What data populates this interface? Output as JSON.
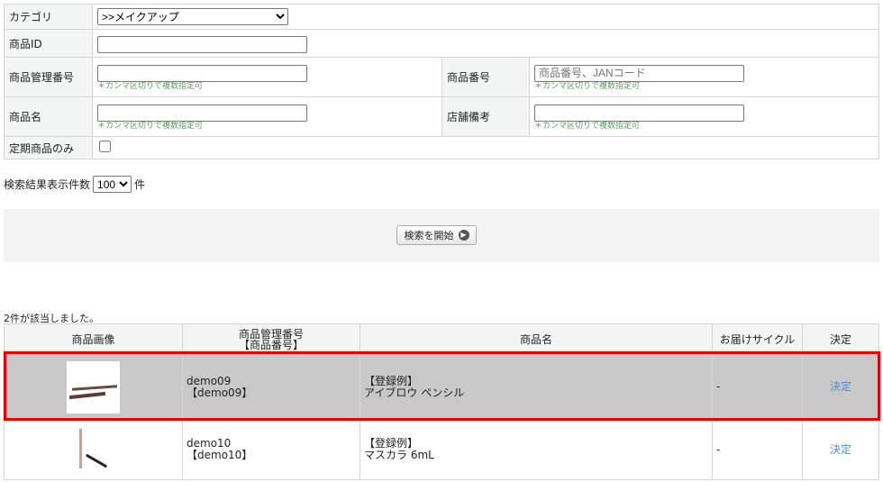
{
  "search": {
    "category_label": "カテゴリ",
    "category_value": ">>メイクアップ",
    "product_id_label": "商品ID",
    "product_id_value": "",
    "mgmt_no_label": "商品管理番号",
    "mgmt_no_value": "",
    "mgmt_no_note": "＊カンマ区切りで複数指定可",
    "product_no_label": "商品番号",
    "product_no_placeholder": "商品番号、JANコード",
    "product_no_note": "＊カンマ区切りで複数指定可",
    "name_label": "商品名",
    "name_value": "",
    "name_note": "＊カンマ区切りで複数指定可",
    "store_note_label": "店舗備考",
    "store_note_value": "",
    "store_note_note": "＊カンマ区切りで複数指定可",
    "subscription_label": "定期商品のみ"
  },
  "count": {
    "label": "検索結果表示件数",
    "value": "100",
    "unit": "件"
  },
  "search_button": "検索を開始",
  "results": {
    "summary": "2件が該当しました。",
    "headers": [
      "商品画像",
      "商品管理番号",
      "【商品番号】",
      "商品名",
      "お届けサイクル",
      "決定"
    ],
    "rows": [
      {
        "mgmt": "demo09",
        "no": "【demo09】",
        "name1": "【登録例】",
        "name2": "アイブロウ ペンシル",
        "cycle": "-",
        "action": "決定"
      },
      {
        "mgmt": "demo10",
        "no": "【demo10】",
        "name1": "【登録例】",
        "name2": "マスカラ 6mL",
        "cycle": "-",
        "action": "決定"
      }
    ]
  }
}
